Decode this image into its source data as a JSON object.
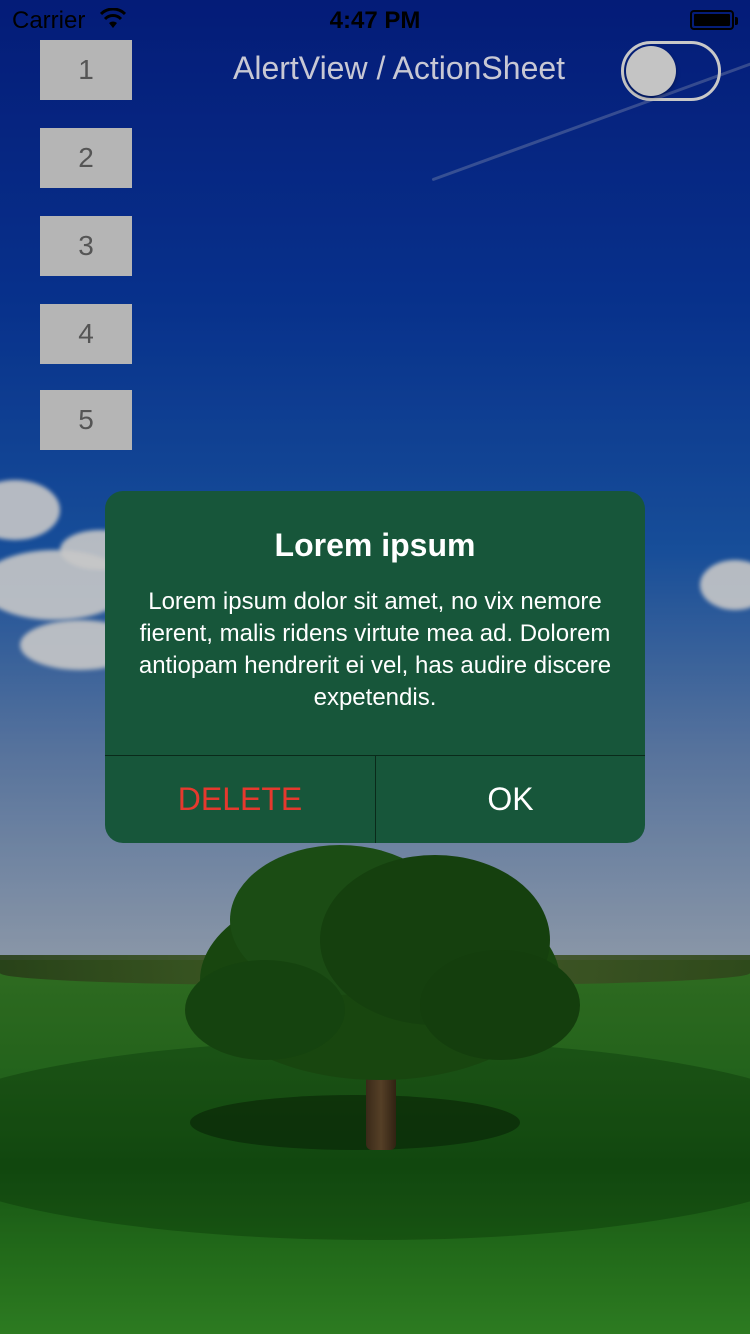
{
  "status_bar": {
    "carrier": "Carrier",
    "time": "4:47 PM",
    "wifi_icon": "wifi-icon",
    "battery_icon": "battery-icon"
  },
  "buttons": [
    {
      "label": "1"
    },
    {
      "label": "2"
    },
    {
      "label": "3"
    },
    {
      "label": "4"
    },
    {
      "label": "5"
    }
  ],
  "header": {
    "title": "AlertView / ActionSheet",
    "toggle_on": false
  },
  "alert": {
    "title": "Lorem ipsum",
    "message": "Lorem ipsum dolor sit amet, no vix nemore fierent, malis ridens virtute mea ad. Dolorem antiopam hendrerit ei vel, has audire discere expetendis.",
    "delete_label": "DELETE",
    "ok_label": "OK",
    "background_color": "#17563a",
    "delete_color": "#e5392e"
  }
}
